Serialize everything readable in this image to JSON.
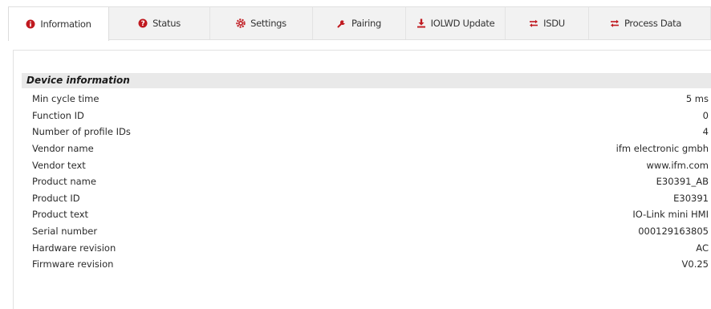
{
  "tabs": [
    {
      "label": "Information",
      "icon": "info-icon",
      "icon_color": "#c0191f",
      "active": true
    },
    {
      "label": "Status",
      "icon": "question-icon",
      "icon_color": "#c0191f",
      "active": false
    },
    {
      "label": "Settings",
      "icon": "gear-icon",
      "icon_color": "#c0191f",
      "active": false
    },
    {
      "label": "Pairing",
      "icon": "wrench-icon",
      "icon_color": "#c0191f",
      "active": false
    },
    {
      "label": "IOLWD Update",
      "icon": "download-icon",
      "icon_color": "#c0191f",
      "active": false
    },
    {
      "label": "ISDU",
      "icon": "exchange-icon",
      "icon_color": "#c0191f",
      "active": false
    },
    {
      "label": "Process Data",
      "icon": "exchange-icon",
      "icon_color": "#c0191f",
      "active": false
    }
  ],
  "section": {
    "title": "Device information"
  },
  "rows": [
    {
      "label": "Min cycle time",
      "value": "5 ms"
    },
    {
      "label": "Function ID",
      "value": "0"
    },
    {
      "label": "Number of profile IDs",
      "value": "4"
    },
    {
      "label": "Vendor name",
      "value": "ifm electronic gmbh"
    },
    {
      "label": "Vendor text",
      "value": "www.ifm.com"
    },
    {
      "label": "Product name",
      "value": "E30391_AB"
    },
    {
      "label": "Product ID",
      "value": "E30391"
    },
    {
      "label": "Product text",
      "value": "IO-Link mini HMI"
    },
    {
      "label": "Serial number",
      "value": "000129163805"
    },
    {
      "label": "Hardware revision",
      "value": "AC"
    },
    {
      "label": "Firmware revision",
      "value": "V0.25"
    }
  ],
  "colors": {
    "accent": "#c0191f",
    "header_bg": "#e9e9e9",
    "tab_bar_bg": "#f2f2f2"
  }
}
